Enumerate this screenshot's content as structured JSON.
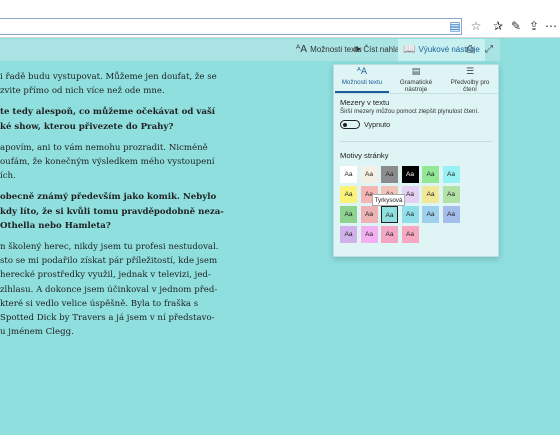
{
  "browser": {
    "icons": [
      "reading-view-icon",
      "favorite-star-icon",
      "favorites-hub-icon",
      "pen-icon",
      "share-icon",
      "more-icon"
    ]
  },
  "toolbar": {
    "text_options": "Možnosti textu",
    "read_aloud": "Číst nahlas",
    "learning_tools": "Výukové nástroje"
  },
  "article": {
    "paragraphs": [
      {
        "bold": false,
        "lines": [
          "i řadě budu vystupovat. Můžeme jen doufat, že se",
          "zvite přímo od nich více než ode mne."
        ]
      },
      {
        "bold": true,
        "lines": [
          "te tedy alespoň, co můžeme očekávat od vaší",
          "ké show, kterou přivezete do Prahy?"
        ]
      },
      {
        "bold": false,
        "lines": [
          "apovím, ani to vám nemohu prozradit. Nicméně",
          "oufám, že konečným výsledkem mého vystoupení",
          "ích."
        ]
      },
      {
        "bold": true,
        "lines": [
          "obecně známý především jako komik. Nebylo",
          "kdy líto, že si kvůli tomu pravděpodobně neza-",
          " Othella nebo Hamleta?"
        ]
      },
      {
        "bold": false,
        "lines": [
          "n školený herec, nikdy jsem tu profesi nestudoval.",
          "sto se mi podařilo získat pár příležitostí, kde jsem",
          " herecké prostředky využil, jednak v televizi, jed-",
          "zlhlasu. A dokonce jsem účinkoval v jednom před-",
          " které si vedlo velice úspěšně. Byla to fraška s",
          " Spotted Dick by Travers a já jsem v ní představo-",
          "u jménem Clegg."
        ]
      }
    ]
  },
  "panel": {
    "tabs": [
      {
        "label": "Možnosti textu",
        "icon": "text-options-icon",
        "active": true
      },
      {
        "label": "Gramatické nástroje",
        "icon": "grammar-tools-icon",
        "active": false
      },
      {
        "label": "Předvolby pro čtení",
        "icon": "reading-preferences-icon",
        "active": false
      }
    ],
    "spacing_title": "Mezery v textu",
    "spacing_desc": "Širší mezery můžou pomoct zlepšit plynulost čtení.",
    "toggle_label": "Vypnuto",
    "themes_title": "Motivy stránky",
    "swatch_text": "Aa",
    "tooltip": "Tyrkysová",
    "themes": [
      [
        "#ffffff",
        "#f5f0e6",
        "#8c8c8c",
        "#000000",
        "#92e894",
        "#99f1f4"
      ],
      [
        "#fbf27a",
        "#f5b6b4",
        "#f1c3b9",
        "#e4d0f0",
        "#f1e999",
        "#b2e2a6"
      ],
      [
        "#8ed28f",
        "#ecb2b4",
        "#8fdfdf",
        "#90dfe8",
        "#9fd0ee",
        "#a5bdea"
      ],
      [
        "#d0b2ea",
        "#f3b0f0",
        "#f2a6c4",
        "#f7a8c0"
      ]
    ],
    "dark_swatches": [
      "#000000"
    ],
    "selected_theme": "#8fdfdf"
  }
}
